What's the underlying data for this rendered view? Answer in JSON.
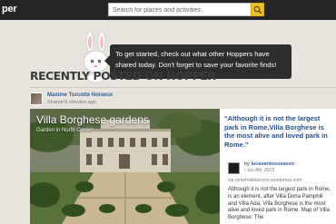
{
  "header": {
    "logo_text": "per",
    "search": {
      "placeholder": "Search for places and activities"
    }
  },
  "notice": {
    "text": "To get started, check out what other Hoppers have shared today. Don't forget to save your favorite finds!"
  },
  "section": {
    "title": "RECENTLY POSTED ON HOPPER"
  },
  "post": {
    "author": "Maxime Turcotte Noiseux",
    "shared_time": "Shared 6 minutes ago",
    "photo_title": "Villa Borghese gardens",
    "photo_subtitle": "Garden in North Center",
    "quote": "“Although it is not the largest park in Rome,Villa Borghese is the most alive and loved park in Rome.”",
    "by_prefix": "by",
    "by_user": "lucasantosusasso",
    "date": "/ Jun 8th, 2013",
    "via": "via romehotelservice.wordpress.com",
    "excerpt": "Although it is not the largest park in Rome, is an element, after Villa Doria Pamphili and Villa Ada, Villa Borghese is the most alive and loved park in Rome. Map of Villa Borghese: The"
  },
  "colors": {
    "topbar": "#252525",
    "accent_search": "#f2c02a",
    "link": "#2d5e9a",
    "quote": "#27508a",
    "background": "#e7e4dd"
  },
  "icons": [
    "search-icon",
    "bunny-mascot-icon"
  ]
}
